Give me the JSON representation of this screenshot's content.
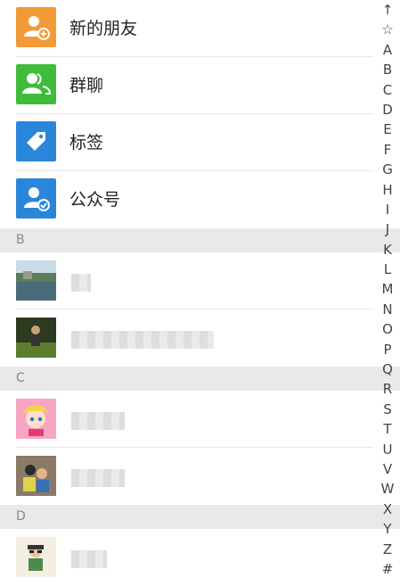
{
  "top_items": [
    {
      "label": "新的朋友",
      "icon": "add-friend-icon",
      "color": "#f29a38"
    },
    {
      "label": "群聊",
      "icon": "group-chat-icon",
      "color": "#3fbd3a"
    },
    {
      "label": "标签",
      "icon": "tag-icon",
      "color": "#2a86d8"
    },
    {
      "label": "公众号",
      "icon": "official-account-icon",
      "color": "#2a86d8"
    }
  ],
  "sections": [
    {
      "letter": "B"
    },
    {
      "letter": "C"
    },
    {
      "letter": "D"
    }
  ],
  "index_letters": [
    "↑",
    "☆",
    "A",
    "B",
    "C",
    "D",
    "E",
    "F",
    "G",
    "H",
    "I",
    "J",
    "K",
    "L",
    "M",
    "N",
    "O",
    "P",
    "Q",
    "R",
    "S",
    "T",
    "U",
    "V",
    "W",
    "X",
    "Y",
    "Z",
    "#"
  ],
  "colors": {
    "section_bg": "#e9e9e9",
    "divider": "#e8e8e8"
  }
}
